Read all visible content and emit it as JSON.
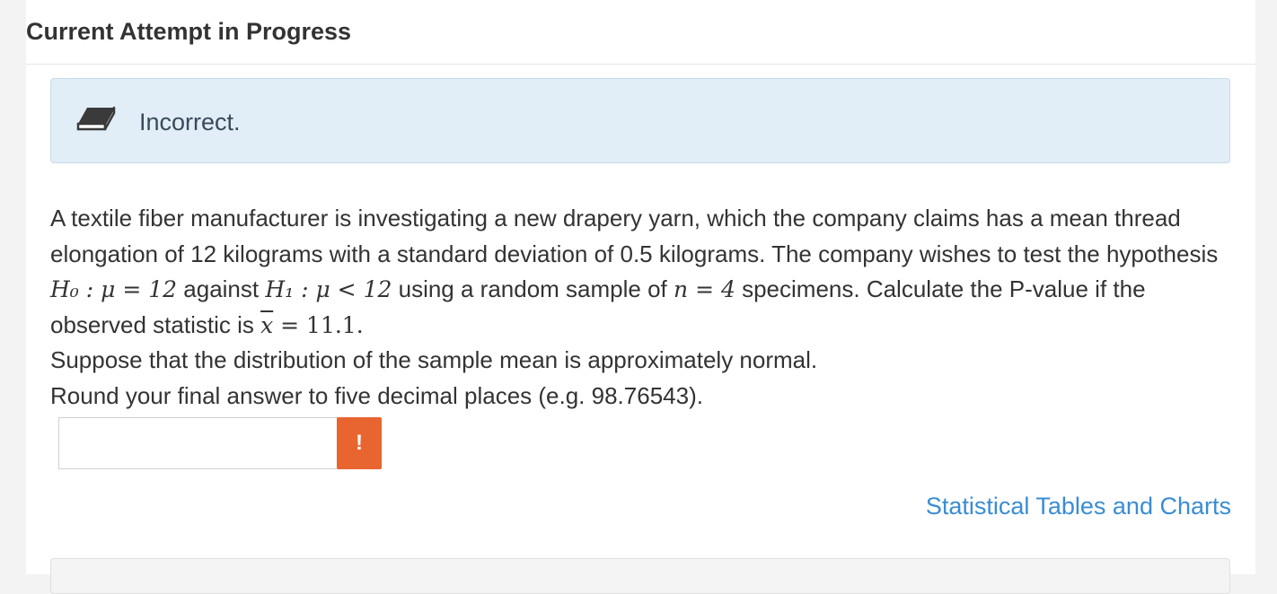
{
  "header": {
    "title": "Current Attempt in Progress"
  },
  "feedback": {
    "icon": "eraser-icon",
    "status": "Incorrect.",
    "color": "#e1edf7"
  },
  "question": {
    "line1": "A textile fiber manufacturer is investigating a new drapery yarn, which the company claims has a mean thread elongation of 12 kilograms with a standard deviation of 0.5 kilograms. The company wishes to test the hypothesis ",
    "h0": "H₀ : μ = 12",
    "mid": " against ",
    "h1": "H₁ : μ < 12",
    "mid2": " using a random sample of ",
    "n": "n = 4",
    "mid3": " specimens. Calculate the P-value if the observed statistic is ",
    "xbar_sym": "x",
    "xbar_val": " = 11.1",
    "end": ".",
    "line2": "Suppose that the distribution of the sample mean is approximately normal.",
    "line3": "Round your final answer to five decimal places (e.g. 98.76543)."
  },
  "answer": {
    "value": "",
    "badge": "!",
    "badge_color": "#e9652f"
  },
  "links": {
    "tables": "Statistical Tables and Charts"
  }
}
